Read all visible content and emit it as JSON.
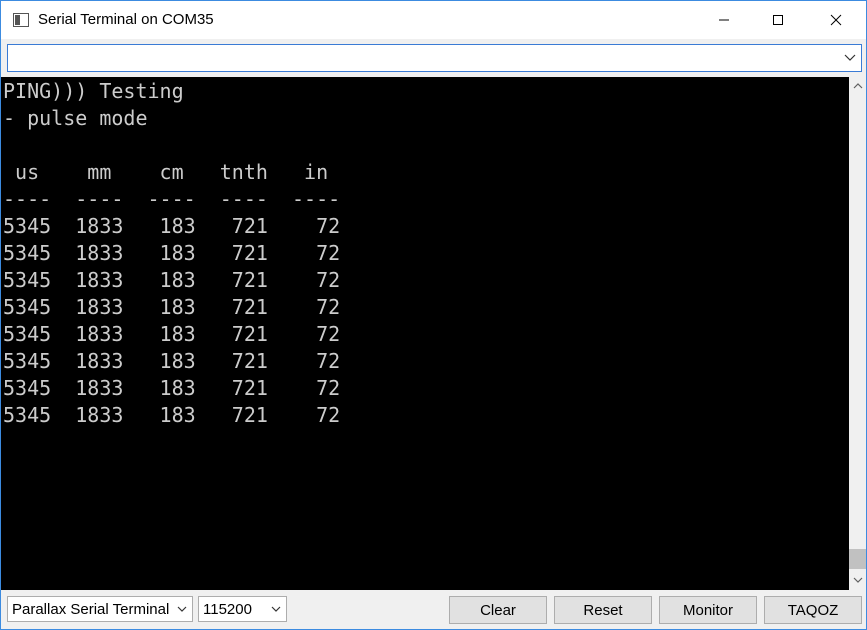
{
  "window": {
    "title": "Serial Terminal on COM35"
  },
  "command": {
    "value": "",
    "placeholder": ""
  },
  "terminal": {
    "lines": [
      "PING))) Testing",
      "- pulse mode",
      "",
      " us    mm    cm   tnth   in",
      "----  ----  ----  ----  ----",
      "5345  1833   183   721    72",
      "5345  1833   183   721    72",
      "5345  1833   183   721    72",
      "5345  1833   183   721    72",
      "5345  1833   183   721    72",
      "5345  1833   183   721    72",
      "5345  1833   183   721    72",
      "5345  1833   183   721    72"
    ],
    "background": "#000000",
    "foreground": "#cccccc"
  },
  "bottombar": {
    "terminal_type": "Parallax Serial Terminal",
    "baud": "115200",
    "clear_label": "Clear",
    "reset_label": "Reset",
    "monitor_label": "Monitor",
    "taqoz_label": "TAQOZ"
  },
  "icons": {
    "app": "terminal-app-icon",
    "minimize": "minimize-icon",
    "maximize": "maximize-icon",
    "close": "close-icon",
    "dropdown": "chevron-down-icon"
  },
  "colors": {
    "window_border": "#3c8be0",
    "combo_focus": "#3a7bd5"
  }
}
